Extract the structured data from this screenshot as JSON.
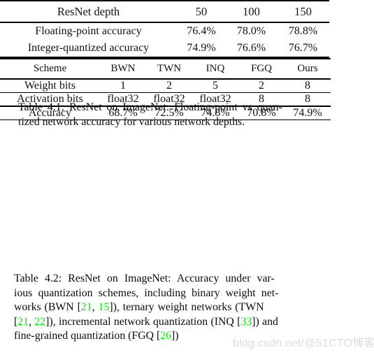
{
  "document": {
    "background_color": "#ffffff",
    "text_color": "#000000",
    "citation_color": "#00ee00",
    "watermark_color": "#dcdcdc"
  },
  "table1": {
    "id": "Table 4.1",
    "header": [
      "ResNet depth",
      "50",
      "100",
      "150"
    ],
    "rows": [
      {
        "label": "Floating-point accuracy",
        "values": [
          "76.4%",
          "78.0%",
          "78.8%"
        ]
      },
      {
        "label": "Integer-quantized accuracy",
        "values": [
          "74.9%",
          "76.6%",
          "76.7%"
        ]
      }
    ]
  },
  "caption1": {
    "line1": "Table 4.1:  ResNet on ImageNet: Floating-point vs quan-",
    "line2": "tized network accuracy for various network depths."
  },
  "table2": {
    "id": "Table 4.2",
    "header": [
      "Scheme",
      "BWN",
      "TWN",
      "INQ",
      "FGQ",
      "Ours"
    ],
    "rows": [
      {
        "label": "Weight bits",
        "values": [
          "1",
          "2",
          "5",
          "2",
          "8"
        ]
      },
      {
        "label": "Activation bits",
        "values": [
          "float32",
          "float32",
          "float32",
          "8",
          "8"
        ]
      },
      {
        "label": "Accuracy",
        "values": [
          "68.7%",
          "72.5%",
          "74.8%",
          "70.8%",
          "74.9%"
        ]
      }
    ]
  },
  "caption2": {
    "line1": "Table 4.2:  ResNet on ImageNet:  Accuracy under var-",
    "line2": "ious quantization schemes, including binary weight net-",
    "line3_a": "works (BWN [",
    "line3_cite1": "21",
    "line3_b": ", ",
    "line3_cite2": "15",
    "line3_c": "]), ternary weight networks (TWN",
    "line4_a": "[",
    "line4_cite1": "21",
    "line4_b": ", ",
    "line4_cite2": "22",
    "line4_c": "]), incremental network quantization (INQ [",
    "line4_cite3": "33",
    "line4_d": "]) and",
    "line5_a": "fine-grained quantization (FGQ [",
    "line5_cite1": "26",
    "line5_b": "])"
  },
  "watermark": {
    "text": "blog.csdn.net/@51CTO博客"
  }
}
